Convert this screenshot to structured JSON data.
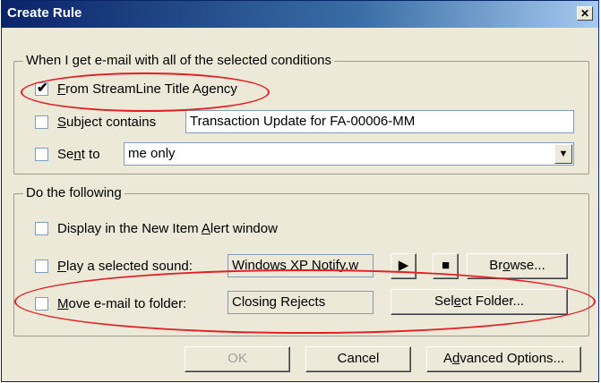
{
  "window": {
    "title": "Create Rule",
    "close_icon": "close-icon"
  },
  "conditions": {
    "legend": "When I get e-mail with all of the selected conditions",
    "from": {
      "label_hot": "F",
      "label_rest": "rom StreamLine Title Agency",
      "checked": true
    },
    "subject": {
      "label_hot": "S",
      "label_rest": "ubject contains",
      "value": "Transaction Update for FA-00006-MM",
      "checked": false
    },
    "sent_to": {
      "label_pre": "Se",
      "label_hot": "n",
      "label_rest": "t to",
      "value": "me only",
      "checked": false
    }
  },
  "actions": {
    "legend": "Do the following",
    "display": {
      "label_pre": "Display in the New Item ",
      "label_hot": "A",
      "label_rest": "lert window",
      "checked": false
    },
    "play": {
      "label_hot": "P",
      "label_rest": "lay a selected sound:",
      "value": "Windows XP Notify.w",
      "checked": false
    },
    "play_icon": "play-icon",
    "stop_icon": "stop-icon",
    "browse": {
      "pre": "Br",
      "hot": "o",
      "rest": "wse..."
    },
    "move": {
      "label_hot": "M",
      "label_rest": "ove e-mail to folder:",
      "value": "Closing Rejects",
      "checked": false
    },
    "select_folder": {
      "pre": "Sel",
      "hot": "e",
      "rest": "ct Folder..."
    }
  },
  "buttons": {
    "ok": "OK",
    "cancel": "Cancel",
    "advanced": {
      "pre": "A",
      "hot": "d",
      "rest": "vanced Options..."
    }
  },
  "colors": {
    "annotation_red": "#e31e24",
    "dialog_bg": "#ece9d8",
    "title_bar": "#0a246a"
  }
}
